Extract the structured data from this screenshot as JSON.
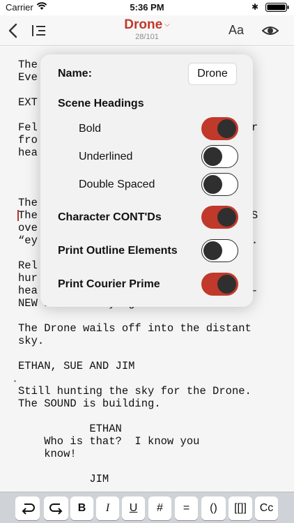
{
  "status_bar": {
    "carrier": "Carrier",
    "time": "5:36 PM"
  },
  "nav": {
    "title": "Drone",
    "page_count": "28/101",
    "font_button": "Aa"
  },
  "script_lines": [
    "The",
    "Eve",
    "",
    "EXT",
    "",
    "Fel                              ater",
    "fro",
    "hea",
    "",
    "",
    "",
    "The",
    "The                              DARS",
    "ove                              gle",
    "“ey                              ack.",
    "",
    "Rel                              ey",
    "hur",
    "hea                              AND-",
    "NEW FAN BELT lying on the road.",
    "",
    "The Drone wails off into the distant",
    "sky.",
    "",
    "ETHAN, SUE AND JIM",
    "",
    "Still hunting the sky for the Drone.",
    "The SOUND is building.",
    "",
    "           ETHAN",
    "    Who is that?  I know you",
    "    know!",
    "",
    "           JIM"
  ],
  "popover": {
    "name_label": "Name:",
    "name_value": "Drone",
    "scene_headings_label": "Scene Headings",
    "bold_label": "Bold",
    "underlined_label": "Underlined",
    "double_spaced_label": "Double Spaced",
    "character_contds_label": "Character CONT'Ds",
    "print_outline_label": "Print Outline Elements",
    "print_courier_label": "Print Courier Prime",
    "toggles": {
      "bold": true,
      "underlined": false,
      "double_spaced": false,
      "character_contds": true,
      "print_outline": false,
      "print_courier": true
    }
  },
  "keyboard_bar": {
    "bold": "B",
    "italic": "I",
    "underline": "U",
    "hash": "#",
    "equals": "=",
    "parens": "()",
    "brackets": "[[]]",
    "cc": "Cc"
  },
  "colors": {
    "accent": "#c0392b",
    "toggle_knob": "#2f2f2f",
    "popover_bg": "#f2f2f2"
  }
}
